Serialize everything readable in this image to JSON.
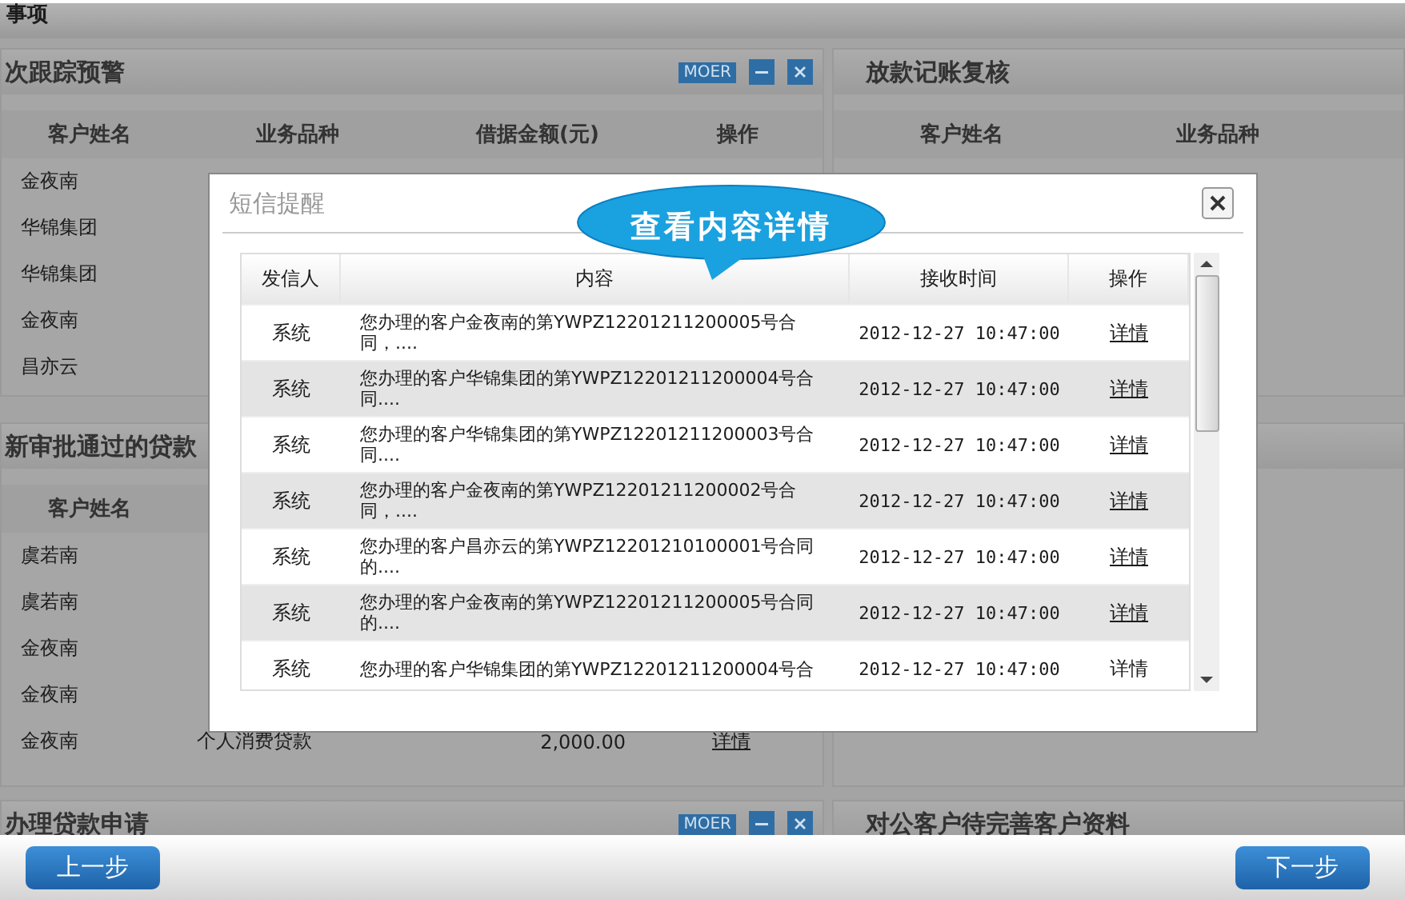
{
  "section_title": "事项",
  "left_panels": [
    {
      "title": "次跟踪预警",
      "more": "MOER",
      "columns": [
        "客户姓名",
        "业务品种",
        "借据金额(元)",
        "操作"
      ],
      "rows": [
        {
          "cells": [
            "金夜南"
          ]
        },
        {
          "cells": [
            "华锦集团"
          ]
        },
        {
          "cells": [
            "华锦集团"
          ]
        },
        {
          "cells": [
            "金夜南"
          ]
        },
        {
          "cells": [
            "昌亦云"
          ]
        }
      ]
    },
    {
      "title": "新审批通过的贷款",
      "columns": [
        "客户姓名"
      ],
      "rows": [
        {
          "cells": [
            "虞若南"
          ]
        },
        {
          "cells": [
            "虞若南"
          ]
        },
        {
          "cells": [
            "金夜南"
          ]
        },
        {
          "cells": [
            "金夜南"
          ]
        },
        {
          "cells": [
            "金夜南",
            "个人消费贷款",
            "2,000.00",
            "详情"
          ]
        }
      ]
    },
    {
      "title": "办理贷款申请",
      "more": "MOER"
    }
  ],
  "right_panels": [
    {
      "title": "放款记账复核",
      "columns": [
        "客户姓名",
        "业务品种"
      ]
    },
    {
      "title": "对公客户待完善客户资料"
    }
  ],
  "dialog": {
    "title": "短信提醒",
    "callout": "查看内容详情",
    "columns": [
      "发信人",
      "内容",
      "接收时间",
      "操作"
    ],
    "rows": [
      {
        "sender": "系统",
        "content": "您办理的客户金夜南的第YWPZ12201211200005号合同，....",
        "time": "2012-12-27 10:47:00",
        "action": "详情",
        "underlined": true
      },
      {
        "sender": "系统",
        "content": "您办理的客户华锦集团的第YWPZ12201211200004号合同....",
        "time": "2012-12-27 10:47:00",
        "action": "详情",
        "underlined": true
      },
      {
        "sender": "系统",
        "content": "您办理的客户华锦集团的第YWPZ12201211200003号合同....",
        "time": "2012-12-27 10:47:00",
        "action": "详情",
        "underlined": true
      },
      {
        "sender": "系统",
        "content": "您办理的客户金夜南的第YWPZ12201211200002号合同，....",
        "time": "2012-12-27 10:47:00",
        "action": "详情",
        "underlined": true
      },
      {
        "sender": "系统",
        "content": "您办理的客户昌亦云的第YWPZ12201210100001号合同的....",
        "time": "2012-12-27 10:47:00",
        "action": "详情",
        "underlined": true
      },
      {
        "sender": "系统",
        "content": "您办理的客户金夜南的第YWPZ12201211200005号合同的....",
        "time": "2012-12-27 10:47:00",
        "action": "详情",
        "underlined": true
      },
      {
        "sender": "系统",
        "content": "您办理的客户华锦集团的第YWPZ12201211200004号合",
        "time": "2012-12-27 10:47:00",
        "action": "详情",
        "underlined": false
      }
    ]
  },
  "nav": {
    "back": "上一步",
    "next": "下一步"
  }
}
